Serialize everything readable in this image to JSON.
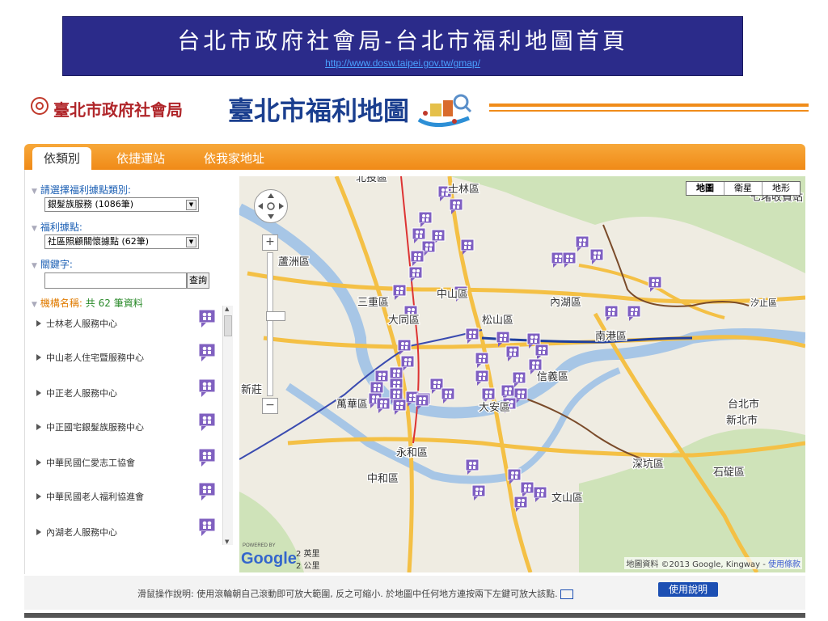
{
  "banner": {
    "title": "台北市政府社會局-台北市福利地圖首頁",
    "url": "http://www.dosw.taipei.gov.tw/gmap/"
  },
  "header": {
    "org_name": "臺北市政府社會局",
    "site_title": "臺北市福利地圖",
    "accent_color": "#f08c1a"
  },
  "nav": {
    "tabs": [
      {
        "label": "依類別",
        "active": true
      },
      {
        "label": "依捷運站",
        "active": false
      },
      {
        "label": "依我家地址",
        "active": false
      }
    ]
  },
  "filters": {
    "category_label": "請選擇福利據點類別:",
    "category_value": "銀髮族服務 (1086筆)",
    "point_label": "福利據點:",
    "point_value": "社區照顧關懷據點 (62筆)",
    "keyword_label": "關鍵字:",
    "keyword_value": "",
    "search_button": "查詢"
  },
  "results": {
    "count_label": "機構名稱:",
    "count_text": "共 62 筆資料",
    "items": [
      "士林老人服務中心",
      "中山老人住宅暨服務中心",
      "中正老人服務中心",
      "中正國宅銀髮族服務中心",
      "中華民國仁愛志工協會",
      "中華民國老人福利協進會",
      "內湖老人服務中心"
    ]
  },
  "map": {
    "map_types": [
      "地圖",
      "衛星",
      "地形"
    ],
    "scale": [
      "2 英里",
      "2 公里"
    ],
    "copyright": "地圖資料 ©2013 Google, Kingway - ",
    "terms": "使用條款",
    "google": "Google",
    "powered_by": "POWERED BY",
    "districts": [
      "北投區",
      "士林區",
      "蘆洲區",
      "三重區",
      "中山區",
      "大同區",
      "松山區",
      "內湖區",
      "南港區",
      "萬華區",
      "大安區",
      "信義區",
      "永和區",
      "中和區",
      "文山區",
      "新莊",
      "深坑區",
      "石碇區",
      "新北市",
      "台北市",
      "汐止區",
      "七堵收費站"
    ]
  },
  "footer": {
    "instructions": "滑鼠操作說明: 使用滾輪朝自己滾動即可放大範圍, 反之可縮小. 於地圖中任何地方連按兩下左鍵可放大該點.",
    "help_button": "使用說明"
  }
}
